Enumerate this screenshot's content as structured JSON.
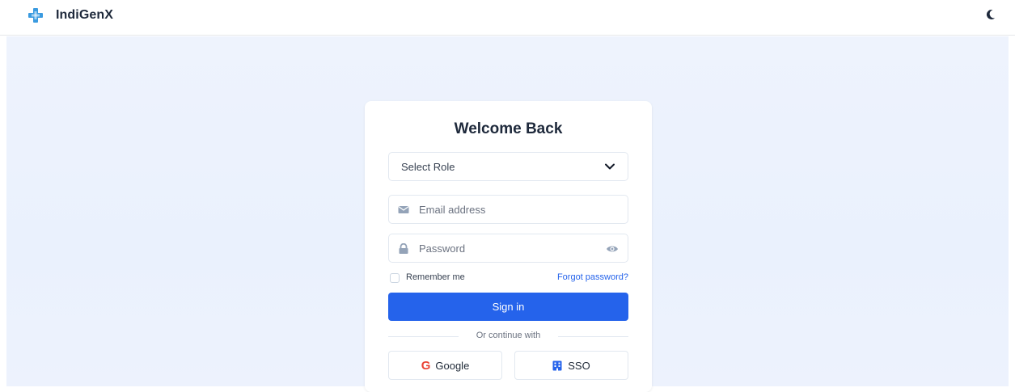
{
  "app": {
    "name": "IndiGenX",
    "brand_icon": "medical-cross-icon",
    "theme_icon": "moon-icon"
  },
  "colors": {
    "accent": "#2563eb",
    "background": "#eef3fd",
    "brand_icon": "#3b9be0"
  },
  "login": {
    "title": "Welcome Back",
    "role_select": {
      "value": "Select Role",
      "icon": "chevron-down-icon"
    },
    "email": {
      "placeholder": "Email address",
      "icon": "envelope-icon"
    },
    "password": {
      "placeholder": "Password",
      "icon": "lock-icon",
      "toggle_icon": "eye-icon"
    },
    "remember_me": "Remember me",
    "forgot_password": "Forgot password?",
    "sign_in": "Sign in",
    "divider": "Or continue with",
    "google": "Google",
    "sso": "SSO"
  }
}
